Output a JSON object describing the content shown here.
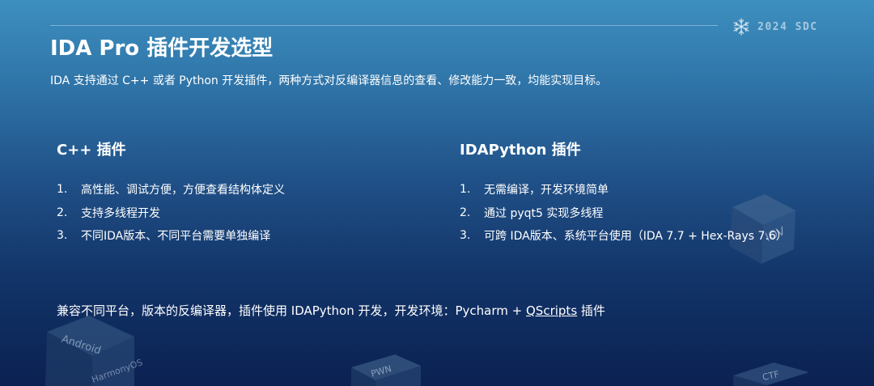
{
  "header": {
    "brand_text": "2024 SDC",
    "brand_icon": "snowflake-icon"
  },
  "title": "IDA Pro 插件开发选型",
  "subtitle": "IDA 支持通过 C++ 或者 Python 开发插件，两种方式对反编译器信息的查看、修改能力一致，均能实现目标。",
  "left_column": {
    "heading": "C++ 插件",
    "items": [
      {
        "num": "1.",
        "text": "高性能、调试方便，方便查看结构体定义"
      },
      {
        "num": "2.",
        "text": "支持多线程开发"
      },
      {
        "num": "3.",
        "text": "不同IDA版本、不同平台需要单独编译"
      }
    ]
  },
  "right_column": {
    "heading": "IDAPython 插件",
    "items": [
      {
        "num": "1.",
        "text": "无需编译，开发环境简单"
      },
      {
        "num": "2.",
        "text": "通过 pyqt5 实现多线程"
      },
      {
        "num": "3.",
        "text": "可跨 IDA版本、系统平台使用（IDA 7.7 + Hex-Rays 7.6）"
      }
    ]
  },
  "note": {
    "before": "兼容不同平台，版本的反编译器，插件使用 IDAPython 开发，开发环境：Pycharm + ",
    "link": "QScripts",
    "after": " 插件"
  },
  "decor": {
    "cube_android": "Android",
    "cube_harmony": "HarmonyOS",
    "cube_pwn": "PWN",
    "cube_iov": "IOV",
    "cube_ctf": "CTF"
  },
  "colors": {
    "bg_top": "#3d8fbf",
    "bg_bottom": "#0b2152",
    "text": "#ffffff"
  }
}
